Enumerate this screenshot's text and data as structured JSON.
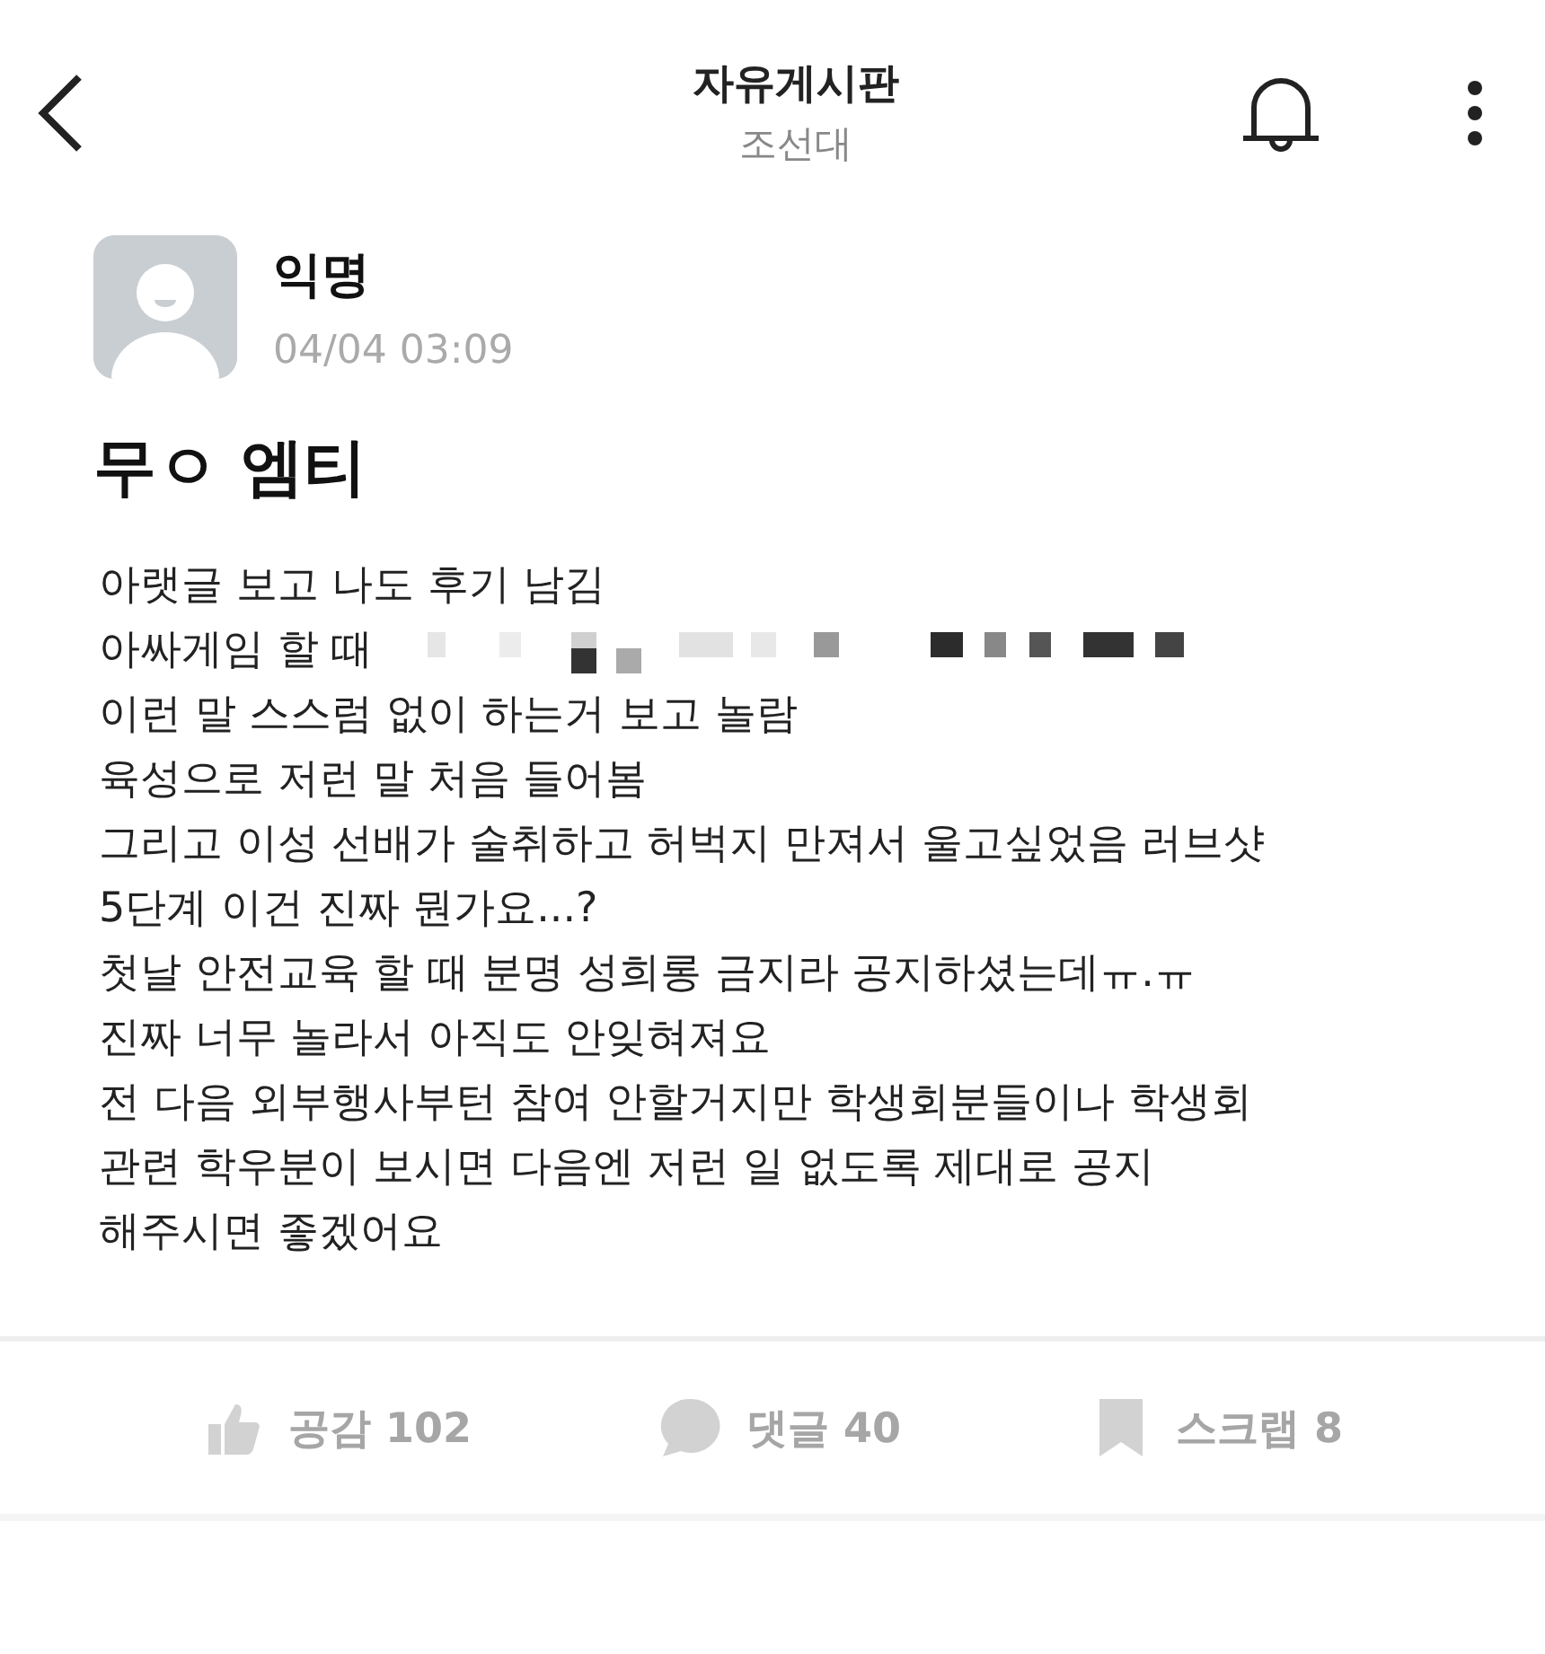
{
  "header": {
    "title": "자유게시판",
    "subtitle": "조선대"
  },
  "post": {
    "author": "익명",
    "time": "04/04 03:09",
    "title": "무ㅇ 엠티",
    "lines": [
      {
        "text": "아랫글 보고 나도 후기 남김",
        "redacted": false
      },
      {
        "text": "아싸게임 할 때",
        "redacted": true
      },
      {
        "text": "이런 말 스스럼 없이 하는거 보고 놀람",
        "redacted": false
      },
      {
        "text": "육성으로 저런 말 처음 들어봄",
        "redacted": false
      },
      {
        "text": "그리고 이성 선배가 술취하고 허벅지 만져서 울고싶었음 러브샷",
        "redacted": false
      },
      {
        "text": "5단계 이건 진짜 뭔가요...?",
        "redacted": false
      },
      {
        "text": "첫날 안전교육 할 때 분명 성희롱 금지라 공지하셨는데ㅠ.ㅠ",
        "redacted": false
      },
      {
        "text": "진짜 너무 놀라서 아직도 안잊혀져요",
        "redacted": false
      },
      {
        "text": "전 다음 외부행사부턴 참여 안할거지만 학생회분들이나 학생회",
        "redacted": false
      },
      {
        "text": "관련 학우분이 보시면 다음엔 저런 일 없도록 제대로 공지",
        "redacted": false
      },
      {
        "text": "해주시면 좋겠어요",
        "redacted": false
      }
    ]
  },
  "actions": [
    {
      "kind": "like",
      "label": "공감 102"
    },
    {
      "kind": "comment",
      "label": "댓글 40"
    },
    {
      "kind": "scrap",
      "label": "스크랩 8"
    }
  ]
}
